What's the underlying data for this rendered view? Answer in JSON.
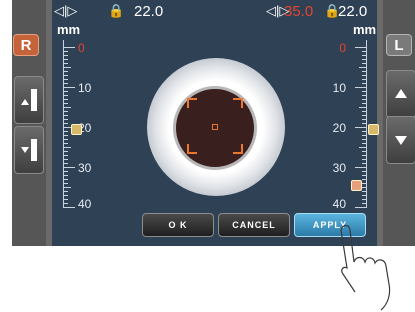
{
  "eye_buttons": {
    "right": "R",
    "left": "L"
  },
  "units": {
    "left": "mm",
    "right": "mm"
  },
  "top_bar": {
    "left_value": "22.0",
    "right_red_value": "35.0",
    "right_value": "22.0"
  },
  "ruler_labels": [
    "0",
    "10",
    "20",
    "30",
    "40"
  ],
  "actions": {
    "ok": "O K",
    "cancel": "CANCEL",
    "apply": "APPLY"
  },
  "icons": {
    "top_left_arrows": "horizontal-arrows-icon",
    "top_lock": "lock-icon",
    "side_up": "arrow-up-icon",
    "side_down": "arrow-down-icon"
  },
  "colors": {
    "accent": "#e2452c",
    "apply": "#2c7aa8",
    "screen": "#2f4155"
  }
}
